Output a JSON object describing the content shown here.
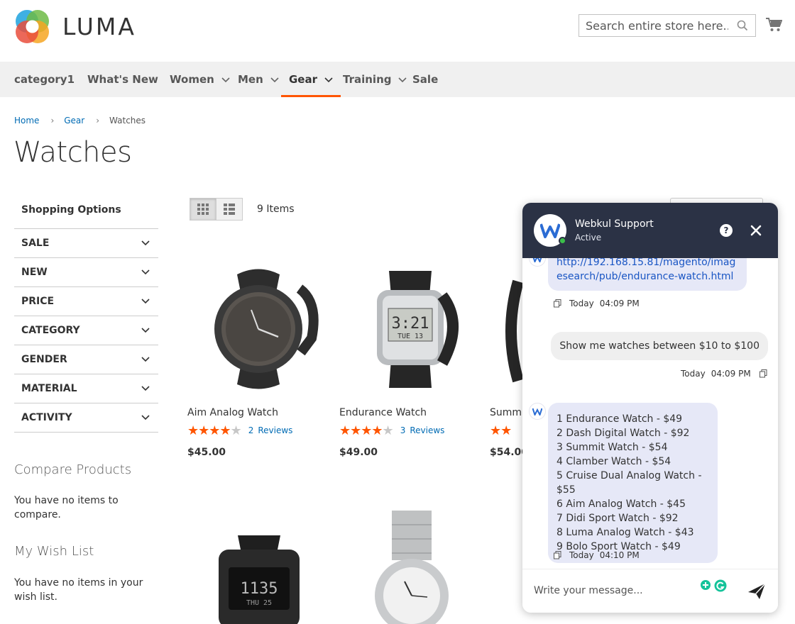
{
  "brand": {
    "name": "LUMA"
  },
  "search": {
    "placeholder": "Search entire store here..."
  },
  "nav": [
    {
      "label": "category1",
      "chevron": false
    },
    {
      "label": "What's New",
      "chevron": false
    },
    {
      "label": "Women",
      "chevron": true
    },
    {
      "label": "Men",
      "chevron": true
    },
    {
      "label": "Gear",
      "chevron": true,
      "active": true
    },
    {
      "label": "Training",
      "chevron": true
    },
    {
      "label": "Sale",
      "chevron": false
    }
  ],
  "breadcrumb": {
    "home": "Home",
    "gear": "Gear",
    "current": "Watches"
  },
  "page": {
    "title": "Watches"
  },
  "sidebar": {
    "title": "Shopping Options",
    "filters": [
      "SALE",
      "NEW",
      "PRICE",
      "CATEGORY",
      "GENDER",
      "MATERIAL",
      "ACTIVITY"
    ],
    "compare_title": "Compare Products",
    "compare_text": "You have no items to compare.",
    "wish_title": "My Wish List",
    "wish_text": "You have no items in your wish list."
  },
  "toolbar": {
    "count": "9 Items"
  },
  "products": [
    {
      "name": "Aim Analog Watch",
      "rating": 4,
      "reviews_count": "2",
      "reviews_label": "Reviews",
      "price": "$45.00"
    },
    {
      "name": "Endurance Watch",
      "rating": 4.5,
      "reviews_count": "3",
      "reviews_label": "Reviews",
      "price": "$49.00"
    },
    {
      "name": "Summ",
      "rating": 2,
      "reviews_count": "",
      "reviews_label": "",
      "price": "$54.00"
    }
  ],
  "chat": {
    "agent_name": "Webkul Support",
    "status": "Active",
    "help": "?",
    "messages": {
      "m1_link": "http://192.168.15.81/magento/imagesearch/pub/endurance-watch.html",
      "m1_day": "Today",
      "m1_time": "04:09 PM",
      "m2_text": "Show me watches between $10 to $100",
      "m2_day": "Today",
      "m2_time": "04:09 PM",
      "m3_lines": [
        "1 Endurance Watch - $49",
        "2 Dash Digital Watch - $92",
        "3 Summit Watch - $54",
        "4 Clamber Watch - $54",
        "5 Cruise Dual Analog Watch - $55",
        "6 Aim Analog Watch - $45",
        "7 Didi Sport Watch - $92",
        "8 Luma Analog Watch - $43",
        "9 Bolo Sport Watch - $49"
      ],
      "m3_day": "Today",
      "m3_time": "04:10 PM"
    },
    "input_placeholder": "Write your message..."
  },
  "colors": {
    "accent": "#ff5501",
    "link": "#006bb4",
    "chat_header": "#2b3245",
    "bot_bubble": "#e6e8f7"
  }
}
